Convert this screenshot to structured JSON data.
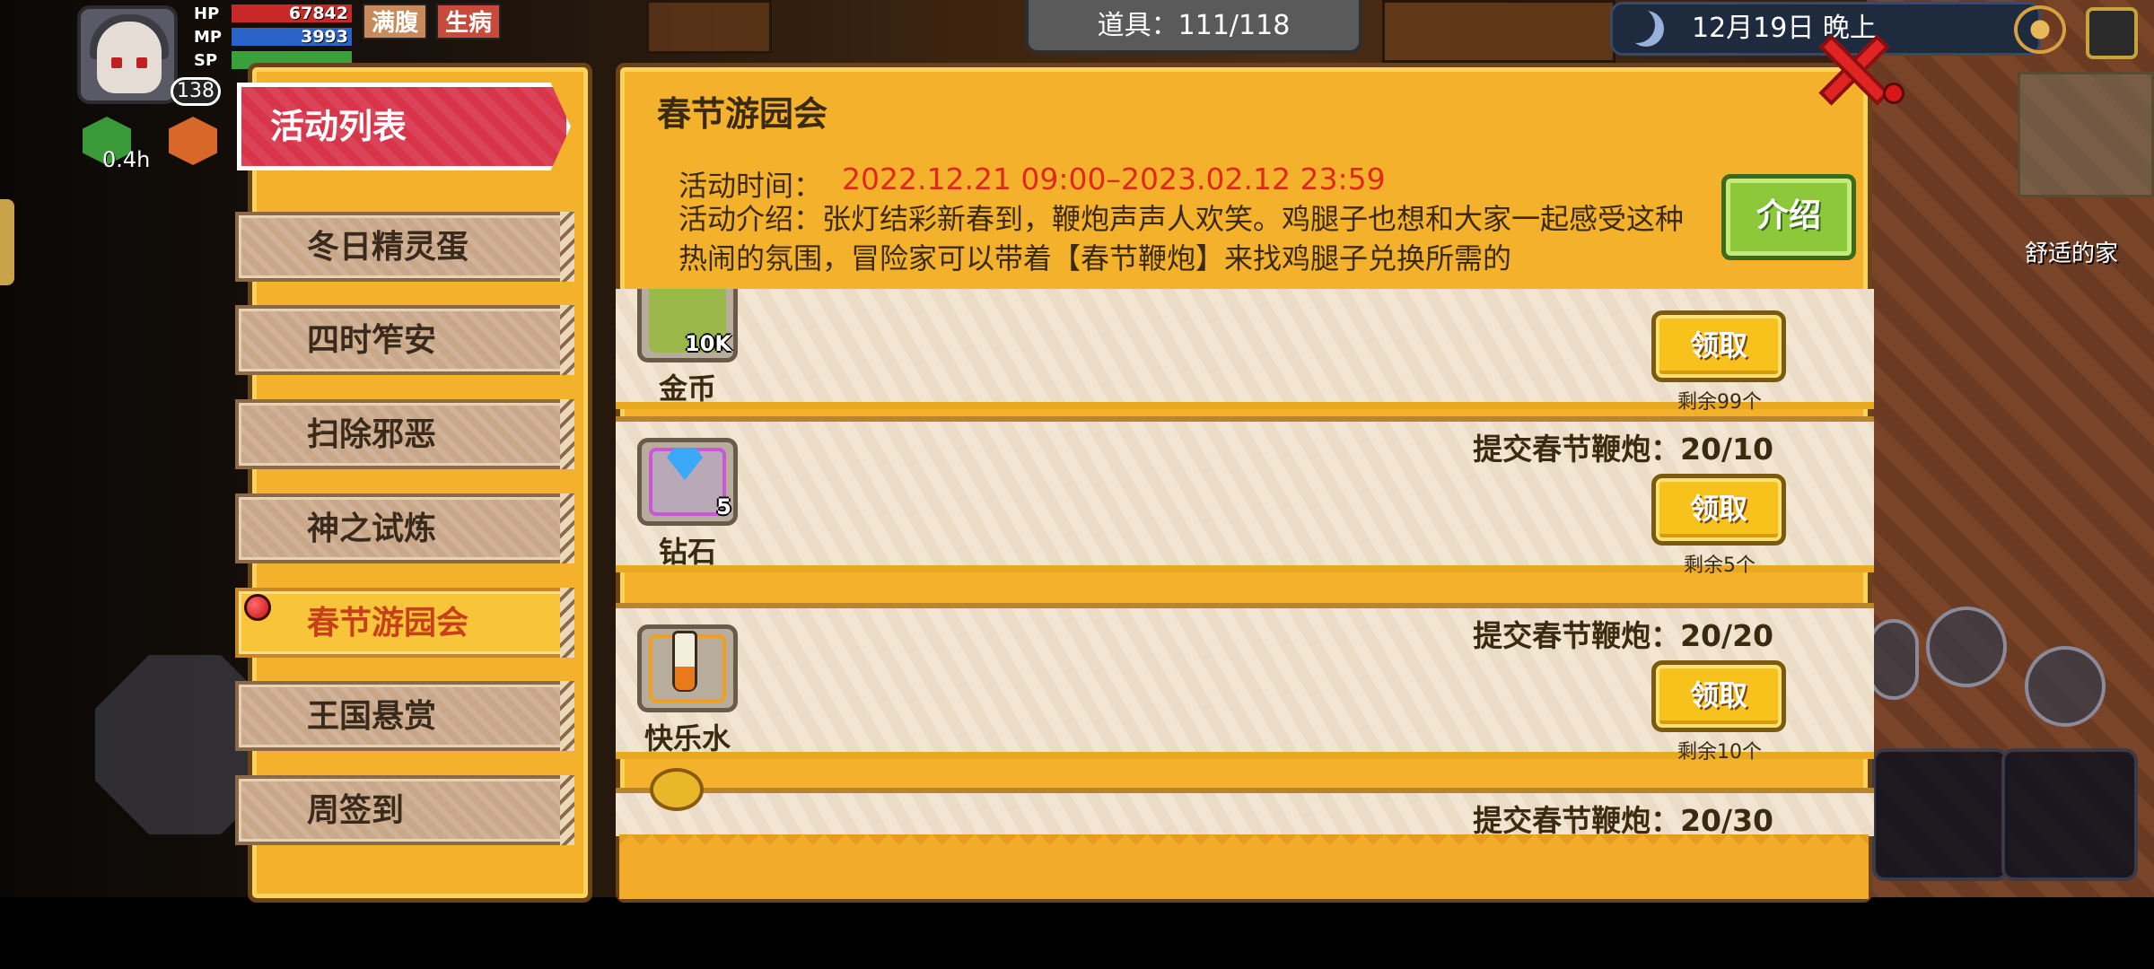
{
  "hud": {
    "hp_label": "HP",
    "hp_value": "67842",
    "mp_label": "MP",
    "mp_value": "3993",
    "sp_label": "SP",
    "level": "138",
    "tag_full": "满腹",
    "tag_sick": "生病",
    "buff_time": "0.4h",
    "item_counter": "道具：111/118",
    "clock": "12月19日 晚上",
    "home_label": "舒适的家"
  },
  "list": {
    "header": "活动列表",
    "items": [
      {
        "label": "冬日精灵蛋"
      },
      {
        "label": "四时笮安"
      },
      {
        "label": "扫除邪恶"
      },
      {
        "label": "神之试炼"
      },
      {
        "label": "春节游园会"
      },
      {
        "label": "王国悬赏"
      },
      {
        "label": "周签到"
      }
    ],
    "active_index": 4
  },
  "event": {
    "title": "春节游园会",
    "time_label": "活动时间：",
    "time_value": "2022.12.21 09:00–2023.02.12 23:59",
    "description": "活动介绍：张灯结彩新春到，鞭炮声声人欢笑。鸡腿子也想和大家一起感受这种热闹的氛围，冒险家可以带着【春节鞭炮】来找鸡腿子兑换所需的",
    "intro_button": "介绍"
  },
  "rewards": [
    {
      "name": "金币",
      "qty": "10K",
      "requirement": "",
      "claim": "领取",
      "remaining": "剩余99个",
      "icon": "coin-icon"
    },
    {
      "name": "钻石",
      "qty": "5",
      "requirement": "提交春节鞭炮：20/10",
      "claim": "领取",
      "remaining": "剩余5个",
      "icon": "diamond-icon"
    },
    {
      "name": "快乐水",
      "qty": "",
      "requirement": "提交春节鞭炮：20/20",
      "claim": "领取",
      "remaining": "剩余10个",
      "icon": "potion-icon"
    },
    {
      "name": "",
      "qty": "",
      "requirement": "提交春节鞭炮：20/30",
      "claim": "",
      "remaining": "",
      "icon": "gold-coin-icon"
    }
  ],
  "colors": {
    "panel": "#f4b22c",
    "header_red": "#d8344a",
    "time_red": "#e0281c",
    "claim_yellow": "#f8c21c",
    "intro_green": "#8cc83a"
  }
}
